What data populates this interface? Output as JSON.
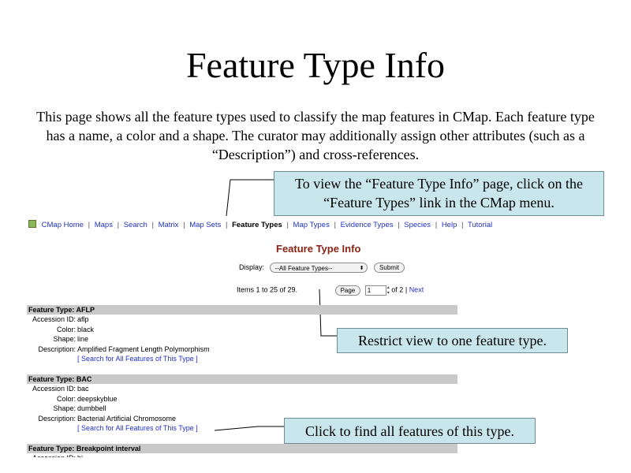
{
  "slide": {
    "title": "Feature Type Info",
    "intro": "This page shows all the feature types used to classify the map features in CMap.  Each feature type has a name, a color and a shape.  The curator may additionally assign other attributes (such as a “Description”) and cross-references."
  },
  "callouts": {
    "menu_hint": "To view the “Feature Type Info” page, click on the “Feature Types” link in the CMap menu.",
    "restrict_hint": "Restrict view to one feature type.",
    "search_hint": "Click to find all features of this type."
  },
  "menu": {
    "items": [
      "CMap Home",
      "Maps",
      "Search",
      "Matrix",
      "Map Sets",
      "Feature Types",
      "Map Types",
      "Evidence Types",
      "Species",
      "Help",
      "Tutorial"
    ],
    "separator": "|"
  },
  "page": {
    "heading": "Feature Type Info",
    "display_label": "Display:",
    "display_value": "--All Feature Types--",
    "submit_label": "Submit",
    "items_text": "Items 1 to 25 of 29.",
    "page_button_label": "Page",
    "page_value": "1",
    "of_text": "of 2",
    "next_label": "Next"
  },
  "labels": {
    "feature_type": "Feature Type:",
    "accession": "Accession ID:",
    "color": "Color:",
    "shape": "Shape:",
    "description": "Description:",
    "search_all": "[ Search for All Features of This Type ]"
  },
  "feature_types": [
    {
      "name": "AFLP",
      "accession": "aflp",
      "color": "black",
      "shape": "line",
      "description": "Amplified Fragment Length Polymorphism"
    },
    {
      "name": "BAC",
      "accession": "bac",
      "color": "deepskyblue",
      "shape": "dumbbell",
      "description": "Bacterial Artificial Chromosome"
    },
    {
      "name": "Breakpoint interval",
      "accession": "bi"
    }
  ],
  "colors": {
    "callout_bg": "#c8e6ec",
    "link": "#2232c6",
    "heading": "#8a2216",
    "header_bar": "#c9c9c9"
  }
}
